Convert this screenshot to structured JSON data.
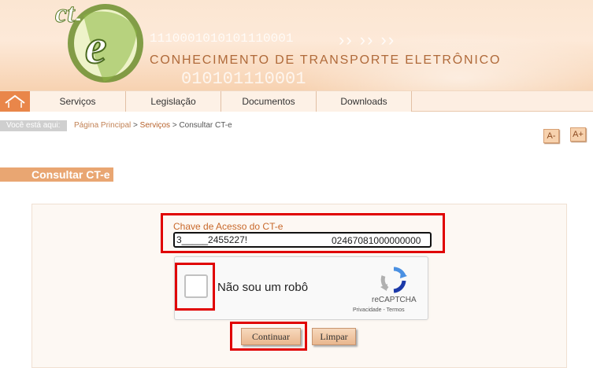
{
  "header": {
    "logo_text": "CT-e",
    "title": "CONHECIMENTO DE TRANSPORTE ELETRÔNICO",
    "binary_top": "1110001010101110001",
    "binary_bottom": "010101110001"
  },
  "nav": {
    "home_icon": "home-icon",
    "items": [
      {
        "label": "Serviços"
      },
      {
        "label": "Legislação"
      },
      {
        "label": "Documentos"
      },
      {
        "label": "Downloads"
      }
    ]
  },
  "breadcrumb": {
    "label": "Você está aqui:",
    "items": [
      "Página Principal",
      "Serviços",
      "Consultar CT-e"
    ],
    "separator": ">"
  },
  "font_controls": {
    "decrease": "A-",
    "increase": "A+"
  },
  "section": {
    "title": "Consultar CT-e"
  },
  "form": {
    "key_label": "Chave de Acesso do CT-e",
    "key_value_start": "3_____2455227!",
    "key_value_end": "02467081000000000"
  },
  "captcha": {
    "text": "Não sou um robô",
    "brand": "reCAPTCHA",
    "links": "Privacidade - Termos"
  },
  "buttons": {
    "continue": "Continuar",
    "clear": "Limpar"
  },
  "colors": {
    "accent": "#e9864a",
    "highlight": "#e00000",
    "label": "#c8682a"
  }
}
